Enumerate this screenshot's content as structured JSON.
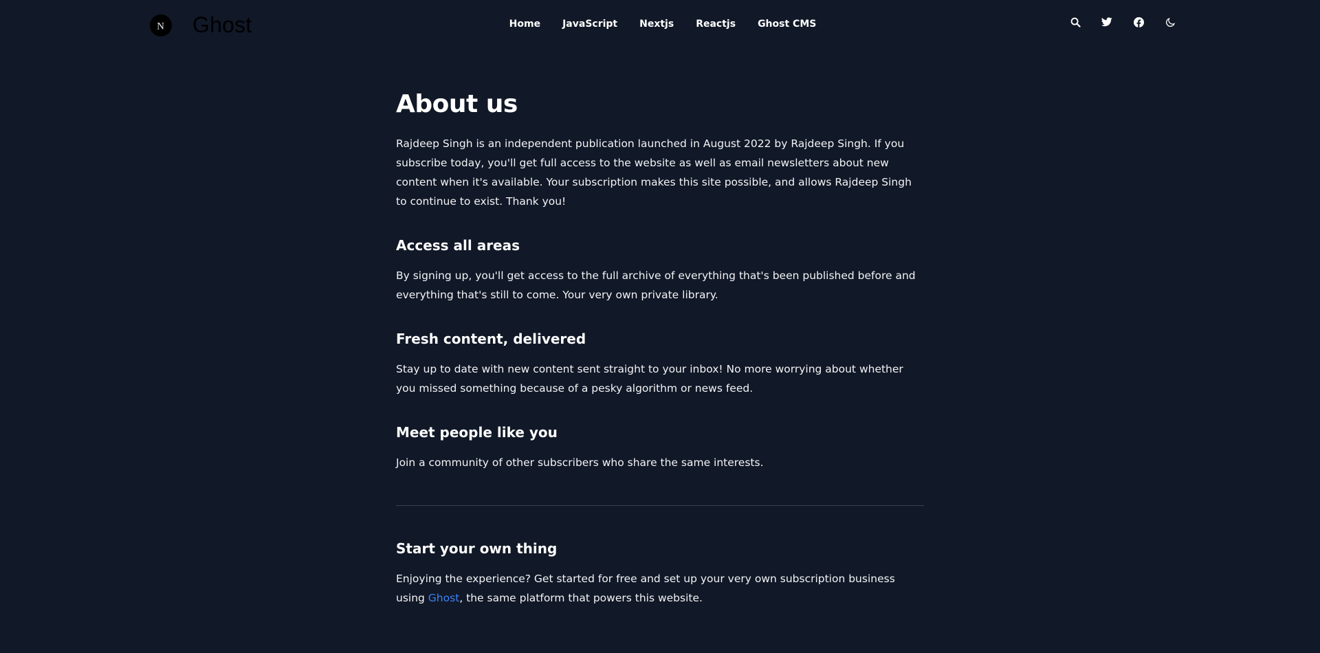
{
  "brand": {
    "logo_letter": "N",
    "name": "Ghost"
  },
  "nav": {
    "items": [
      {
        "label": "Home"
      },
      {
        "label": "JavaScript"
      },
      {
        "label": "Nextjs"
      },
      {
        "label": "Reactjs"
      },
      {
        "label": "Ghost CMS"
      }
    ]
  },
  "toolbar": {
    "icons": [
      "search-icon",
      "twitter-icon",
      "facebook-icon",
      "moon-icon"
    ]
  },
  "page": {
    "title": "About us",
    "intro": "Rajdeep Singh is an independent publication launched in August 2022 by Rajdeep Singh. If you subscribe today, you'll get full access to the website as well as email newsletters about new content when it's available. Your subscription makes this site possible, and allows Rajdeep Singh to continue to exist. Thank you!",
    "sections": [
      {
        "heading": "Access all areas",
        "body": "By signing up, you'll get access to the full archive of everything that's been published before and everything that's still to come. Your very own private library."
      },
      {
        "heading": "Fresh content, delivered",
        "body": "Stay up to date with new content sent straight to your inbox! No more worrying about whether you missed something because of a pesky algorithm or news feed."
      },
      {
        "heading": "Meet people like you",
        "body": "Join a community of other subscribers who share the same interests."
      }
    ],
    "cta": {
      "heading": "Start your own thing",
      "body_before": "Enjoying the experience? Get started for free and set up your very own subscription business using ",
      "link_text": "Ghost",
      "body_after": ", the same platform that powers this website."
    }
  },
  "colors": {
    "background": "#111827",
    "text": "#f3f4f6",
    "link": "#3b82f6",
    "divider": "#374151"
  }
}
